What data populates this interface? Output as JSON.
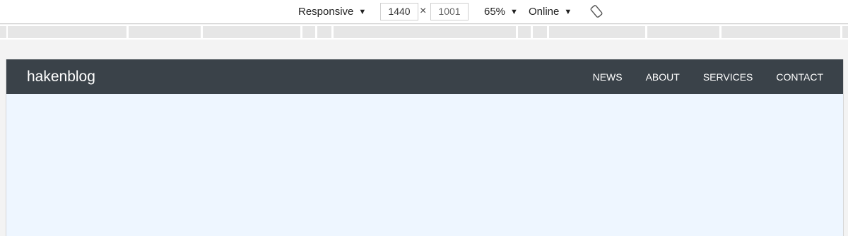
{
  "toolbar": {
    "device": "Responsive",
    "width": "1440",
    "separator": "×",
    "height": "1001",
    "zoom": "65%",
    "network": "Online",
    "dropdown_arrow": "▼",
    "rotate_icon": "rotate-icon"
  },
  "site": {
    "brand": "hakenblog",
    "menu": [
      "NEWS",
      "ABOUT",
      "SERVICES",
      "CONTACT"
    ],
    "colors": {
      "nav_bg": "#3a4249",
      "content_bg": "#eef6ff"
    }
  }
}
